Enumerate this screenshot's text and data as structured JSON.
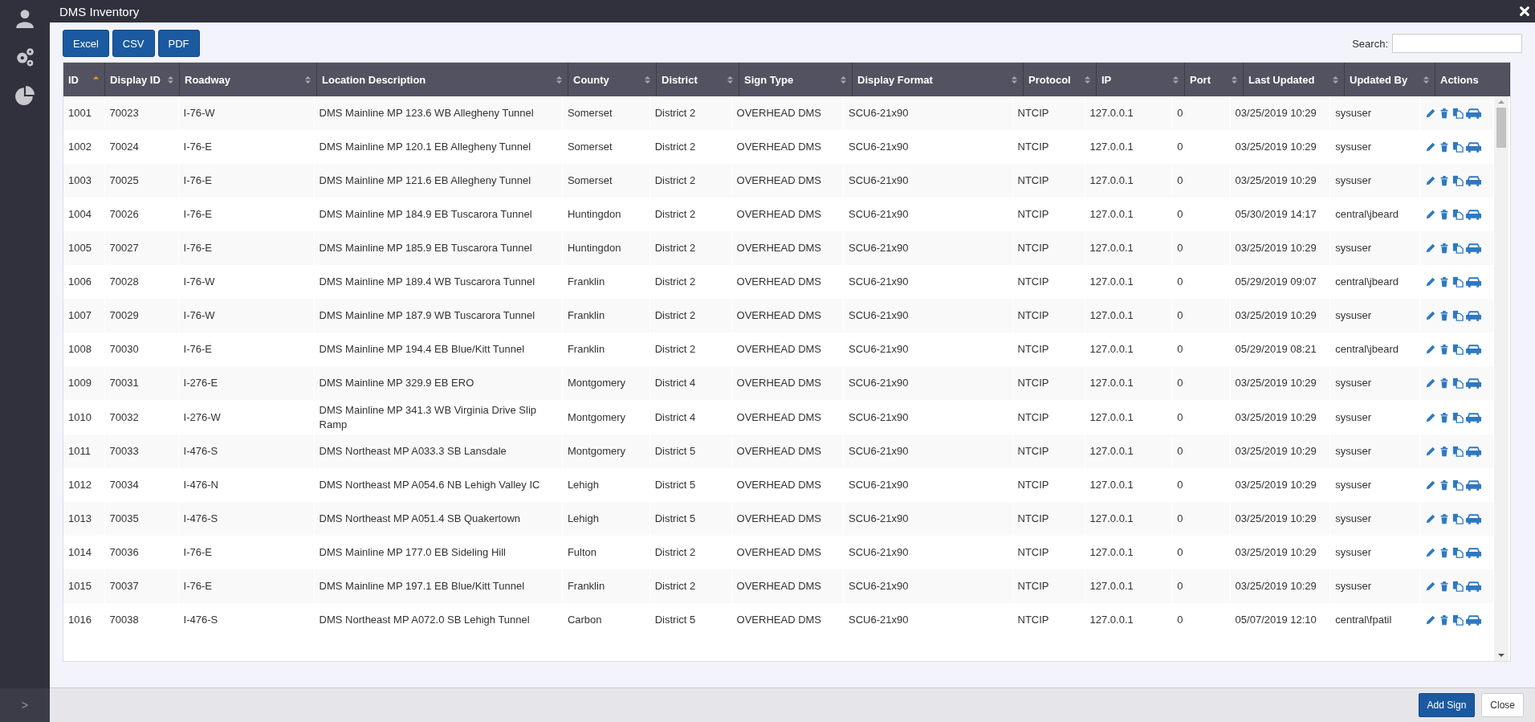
{
  "window": {
    "title": "DMS Inventory"
  },
  "sidebar": {
    "expand": ">"
  },
  "export_buttons": [
    "Excel",
    "CSV",
    "PDF"
  ],
  "search": {
    "label": "Search:"
  },
  "table": {
    "columns": [
      {
        "label": "ID",
        "selected": true
      },
      {
        "label": "Display ID",
        "selected": false
      },
      {
        "label": "Roadway",
        "selected": false
      },
      {
        "label": "Location Description",
        "selected": false
      },
      {
        "label": "County",
        "selected": false
      },
      {
        "label": "District",
        "selected": false
      },
      {
        "label": "Sign Type",
        "selected": false
      },
      {
        "label": "Display Format",
        "selected": false
      },
      {
        "label": "Protocol",
        "selected": false
      },
      {
        "label": "IP",
        "selected": false
      },
      {
        "label": "Port",
        "selected": false
      },
      {
        "label": "Last Updated",
        "selected": false
      },
      {
        "label": "Updated By",
        "selected": false
      },
      {
        "label": "Actions"
      }
    ],
    "rows": [
      [
        "1001",
        "70023",
        "I-76-W",
        "DMS Mainline MP 123.6 WB Allegheny Tunnel",
        "Somerset",
        "District 2",
        "OVERHEAD DMS",
        "SCU6-21x90",
        "NTCIP",
        "127.0.0.1",
        "0",
        "03/25/2019 10:29",
        "sysuser"
      ],
      [
        "1002",
        "70024",
        "I-76-E",
        "DMS Mainline MP 120.1 EB Allegheny Tunnel",
        "Somerset",
        "District 2",
        "OVERHEAD DMS",
        "SCU6-21x90",
        "NTCIP",
        "127.0.0.1",
        "0",
        "03/25/2019 10:29",
        "sysuser"
      ],
      [
        "1003",
        "70025",
        "I-76-E",
        "DMS Mainline MP 121.6 EB Allegheny Tunnel",
        "Somerset",
        "District 2",
        "OVERHEAD DMS",
        "SCU6-21x90",
        "NTCIP",
        "127.0.0.1",
        "0",
        "03/25/2019 10:29",
        "sysuser"
      ],
      [
        "1004",
        "70026",
        "I-76-E",
        "DMS Mainline MP 184.9 EB Tuscarora Tunnel",
        "Huntingdon",
        "District 2",
        "OVERHEAD DMS",
        "SCU6-21x90",
        "NTCIP",
        "127.0.0.1",
        "0",
        "05/30/2019 14:17",
        "central\\jbeard"
      ],
      [
        "1005",
        "70027",
        "I-76-E",
        "DMS Mainline MP 185.9 EB Tuscarora Tunnel",
        "Huntingdon",
        "District 2",
        "OVERHEAD DMS",
        "SCU6-21x90",
        "NTCIP",
        "127.0.0.1",
        "0",
        "03/25/2019 10:29",
        "sysuser"
      ],
      [
        "1006",
        "70028",
        "I-76-W",
        "DMS Mainline MP 189.4 WB Tuscarora Tunnel",
        "Franklin",
        "District 2",
        "OVERHEAD DMS",
        "SCU6-21x90",
        "NTCIP",
        "127.0.0.1",
        "0",
        "05/29/2019 09:07",
        "central\\jbeard"
      ],
      [
        "1007",
        "70029",
        "I-76-W",
        "DMS Mainline MP 187.9 WB Tuscarora Tunnel",
        "Franklin",
        "District 2",
        "OVERHEAD DMS",
        "SCU6-21x90",
        "NTCIP",
        "127.0.0.1",
        "0",
        "03/25/2019 10:29",
        "sysuser"
      ],
      [
        "1008",
        "70030",
        "I-76-E",
        "DMS Mainline MP 194.4 EB Blue/Kitt Tunnel",
        "Franklin",
        "District 2",
        "OVERHEAD DMS",
        "SCU6-21x90",
        "NTCIP",
        "127.0.0.1",
        "0",
        "05/29/2019 08:21",
        "central\\jbeard"
      ],
      [
        "1009",
        "70031",
        "I-276-E",
        "DMS Mainline MP 329.9 EB ERO",
        "Montgomery",
        "District 4",
        "OVERHEAD DMS",
        "SCU6-21x90",
        "NTCIP",
        "127.0.0.1",
        "0",
        "03/25/2019 10:29",
        "sysuser"
      ],
      [
        "1010",
        "70032",
        "I-276-W",
        "DMS Mainline MP 341.3 WB Virginia Drive Slip Ramp",
        "Montgomery",
        "District 4",
        "OVERHEAD DMS",
        "SCU6-21x90",
        "NTCIP",
        "127.0.0.1",
        "0",
        "03/25/2019 10:29",
        "sysuser"
      ],
      [
        "1011",
        "70033",
        "I-476-S",
        "DMS Northeast MP A033.3 SB Lansdale",
        "Montgomery",
        "District 5",
        "OVERHEAD DMS",
        "SCU6-21x90",
        "NTCIP",
        "127.0.0.1",
        "0",
        "03/25/2019 10:29",
        "sysuser"
      ],
      [
        "1012",
        "70034",
        "I-476-N",
        "DMS Northeast MP A054.6 NB Lehigh Valley IC",
        "Lehigh",
        "District 5",
        "OVERHEAD DMS",
        "SCU6-21x90",
        "NTCIP",
        "127.0.0.1",
        "0",
        "03/25/2019 10:29",
        "sysuser"
      ],
      [
        "1013",
        "70035",
        "I-476-S",
        "DMS Northeast MP A051.4 SB Quakertown",
        "Lehigh",
        "District 5",
        "OVERHEAD DMS",
        "SCU6-21x90",
        "NTCIP",
        "127.0.0.1",
        "0",
        "03/25/2019 10:29",
        "sysuser"
      ],
      [
        "1014",
        "70036",
        "I-76-E",
        "DMS Mainline MP 177.0 EB Sideling Hill",
        "Fulton",
        "District 2",
        "OVERHEAD DMS",
        "SCU6-21x90",
        "NTCIP",
        "127.0.0.1",
        "0",
        "03/25/2019 10:29",
        "sysuser"
      ],
      [
        "1015",
        "70037",
        "I-76-E",
        "DMS Mainline MP 197.1 EB Blue/Kitt Tunnel",
        "Franklin",
        "District 2",
        "OVERHEAD DMS",
        "SCU6-21x90",
        "NTCIP",
        "127.0.0.1",
        "0",
        "03/25/2019 10:29",
        "sysuser"
      ],
      [
        "1016",
        "70038",
        "I-476-S",
        "DMS Northeast MP A072.0 SB Lehigh Tunnel",
        "Carbon",
        "District 5",
        "OVERHEAD DMS",
        "SCU6-21x90",
        "NTCIP",
        "127.0.0.1",
        "0",
        "05/07/2019 12:10",
        "central\\fpatil"
      ]
    ]
  },
  "footer_buttons": [
    {
      "label": "Add Sign",
      "kind": "primary"
    },
    {
      "label": "Close",
      "kind": "plain"
    }
  ]
}
